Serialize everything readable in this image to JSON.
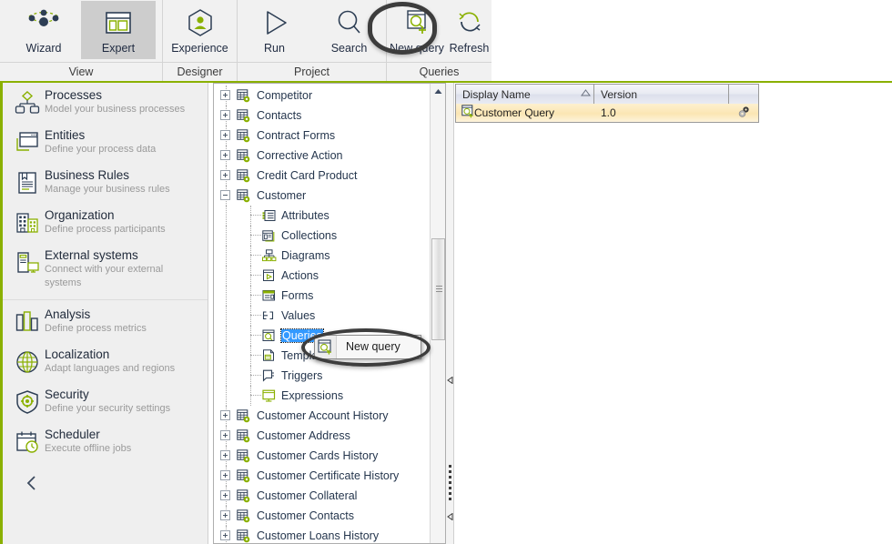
{
  "ribbon": {
    "groups": [
      {
        "name": "View",
        "label": "View",
        "buttons": [
          {
            "label": "Wizard",
            "icon": "wizard-icon",
            "active": false
          },
          {
            "label": "Expert",
            "icon": "expert-icon",
            "active": true
          }
        ]
      },
      {
        "name": "Designer",
        "label": "Designer",
        "buttons": [
          {
            "label": "Experience",
            "icon": "experience-icon",
            "active": false
          }
        ]
      },
      {
        "name": "Project",
        "label": "Project",
        "buttons": [
          {
            "label": "Run",
            "icon": "run-icon",
            "active": false
          },
          {
            "label": "Search",
            "icon": "search-icon",
            "active": false
          }
        ]
      },
      {
        "name": "Queries",
        "label": "Queries",
        "buttons": [
          {
            "label": "New query",
            "icon": "new-query-icon",
            "active": false
          },
          {
            "label": "Refresh",
            "icon": "refresh-icon",
            "active": false
          }
        ]
      }
    ]
  },
  "sidebar": {
    "items": [
      {
        "title": "Processes",
        "subtitle": "Model your business processes",
        "icon": "processes-icon"
      },
      {
        "title": "Entities",
        "subtitle": "Define your process data",
        "icon": "entities-icon"
      },
      {
        "title": "Business Rules",
        "subtitle": "Manage your business rules",
        "icon": "business-rules-icon"
      },
      {
        "title": "Organization",
        "subtitle": "Define process participants",
        "icon": "organization-icon"
      },
      {
        "title": "External systems",
        "subtitle": "Connect with your external systems",
        "icon": "external-systems-icon"
      },
      {
        "title": "Analysis",
        "subtitle": "Define process metrics",
        "icon": "analysis-icon"
      },
      {
        "title": "Localization",
        "subtitle": "Adapt languages and regions",
        "icon": "localization-icon"
      },
      {
        "title": "Security",
        "subtitle": "Define your security settings",
        "icon": "security-icon"
      },
      {
        "title": "Scheduler",
        "subtitle": "Execute offline jobs",
        "icon": "scheduler-icon"
      }
    ],
    "collapse_icon": "chevron-left-icon"
  },
  "tree": {
    "nodes": [
      {
        "label": "Competitor",
        "level": 1,
        "expander": "plus",
        "icon": "entity-icon",
        "selected": false
      },
      {
        "label": "Contacts",
        "level": 1,
        "expander": "plus",
        "icon": "entity-icon",
        "selected": false
      },
      {
        "label": "Contract Forms",
        "level": 1,
        "expander": "plus",
        "icon": "entity-icon",
        "selected": false
      },
      {
        "label": "Corrective Action",
        "level": 1,
        "expander": "plus",
        "icon": "entity-icon",
        "selected": false
      },
      {
        "label": "Credit Card Product",
        "level": 1,
        "expander": "plus",
        "icon": "entity-icon",
        "selected": false
      },
      {
        "label": "Customer",
        "level": 1,
        "expander": "minus",
        "icon": "entity-icon",
        "selected": false
      },
      {
        "label": "Attributes",
        "level": 2,
        "expander": "none",
        "icon": "attributes-icon",
        "selected": false
      },
      {
        "label": "Collections",
        "level": 2,
        "expander": "none",
        "icon": "collections-icon",
        "selected": false
      },
      {
        "label": "Diagrams",
        "level": 2,
        "expander": "none",
        "icon": "diagrams-icon",
        "selected": false
      },
      {
        "label": "Actions",
        "level": 2,
        "expander": "none",
        "icon": "actions-icon",
        "selected": false
      },
      {
        "label": "Forms",
        "level": 2,
        "expander": "none",
        "icon": "forms-icon",
        "selected": false
      },
      {
        "label": "Values",
        "level": 2,
        "expander": "none",
        "icon": "values-icon",
        "selected": false
      },
      {
        "label": "Queries",
        "level": 2,
        "expander": "none",
        "icon": "queries-icon",
        "selected": true
      },
      {
        "label": "Templates",
        "level": 2,
        "expander": "none",
        "icon": "templates-icon",
        "selected": false
      },
      {
        "label": "Triggers",
        "level": 2,
        "expander": "none",
        "icon": "triggers-icon",
        "selected": false
      },
      {
        "label": "Expressions",
        "level": 2,
        "expander": "none",
        "icon": "expressions-icon",
        "selected": false
      },
      {
        "label": "Customer Account History",
        "level": 1,
        "expander": "plus",
        "icon": "entity-icon",
        "selected": false
      },
      {
        "label": "Customer Address",
        "level": 1,
        "expander": "plus",
        "icon": "entity-icon",
        "selected": false
      },
      {
        "label": "Customer Cards History",
        "level": 1,
        "expander": "plus",
        "icon": "entity-icon",
        "selected": false
      },
      {
        "label": "Customer Certificate History",
        "level": 1,
        "expander": "plus",
        "icon": "entity-icon",
        "selected": false
      },
      {
        "label": "Customer Collateral",
        "level": 1,
        "expander": "plus",
        "icon": "entity-icon",
        "selected": false
      },
      {
        "label": "Customer Contacts",
        "level": 1,
        "expander": "plus",
        "icon": "entity-icon",
        "selected": false
      },
      {
        "label": "Customer Loans History",
        "level": 1,
        "expander": "plus",
        "icon": "entity-icon",
        "selected": false
      }
    ]
  },
  "context_menu": {
    "items": [
      {
        "label": "New query",
        "icon": "new-query-icon"
      }
    ]
  },
  "grid": {
    "columns": [
      {
        "label": "Display Name",
        "sort": "ascending"
      },
      {
        "label": "Version",
        "sort": "none"
      },
      {
        "label": "",
        "sort": "none"
      }
    ],
    "rows": [
      {
        "display_name": "Customer Query",
        "version": "1.0",
        "icon": "query-icon",
        "status_icon": "gears-icon",
        "selected": true
      }
    ]
  },
  "colors": {
    "accent_green": "#8ab000",
    "icon_navy": "#2d3e54",
    "selection_blue": "#3399ff",
    "row_highlight": "#fbe6b3"
  }
}
